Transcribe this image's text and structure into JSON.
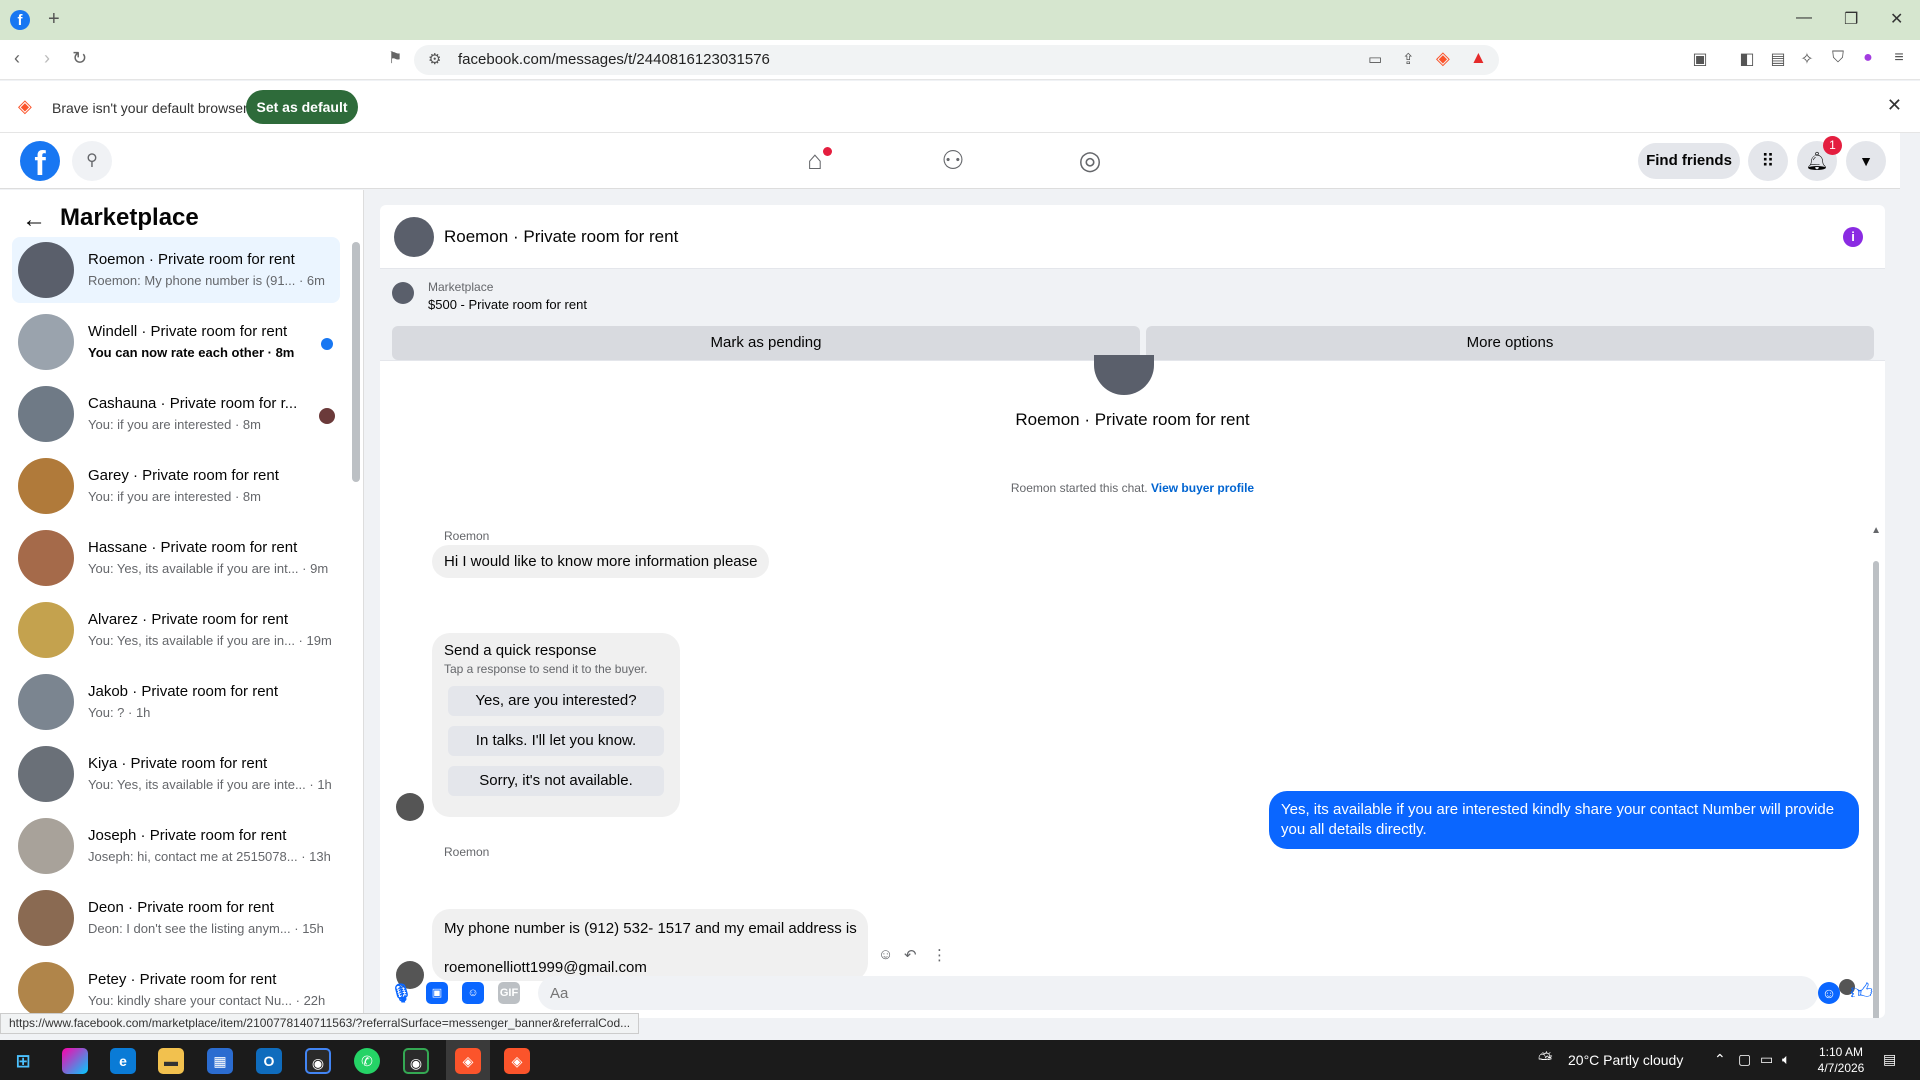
{
  "browser": {
    "tab_icon": "f",
    "url": "facebook.com/messages/t/2440816123031576",
    "infobar_text": "Brave isn't your default browser",
    "set_default_label": "Set as default"
  },
  "fbnav": {
    "logo": "f",
    "find_friends_label": "Find friends",
    "notification_count": "1"
  },
  "sidebar": {
    "title": "Marketplace",
    "conversations": [
      {
        "name": "Roemon · Private room for rent",
        "preview": "Roemon: My phone number is (91...  · 6m",
        "unread": false,
        "active": true,
        "avatar_color": "#5a5f6b"
      },
      {
        "name": "Windell · Private room for rent",
        "preview": "You can now rate each other · 8m",
        "unread": true,
        "active": false,
        "avatar_color": "#9aa3ad"
      },
      {
        "name": "Cashauna · Private room for r...",
        "preview": "You: if you are interested · 8m",
        "unread": false,
        "active": false,
        "avatar_color": "#6f7a86"
      },
      {
        "name": "Garey · Private room for rent",
        "preview": "You: if you are interested · 8m",
        "unread": false,
        "active": false,
        "avatar_color": "#b07a3a"
      },
      {
        "name": "Hassane · Private room for rent",
        "preview": "You: Yes, its available if you are int... · 9m",
        "unread": false,
        "active": false,
        "avatar_color": "#a56a4a"
      },
      {
        "name": "Alvarez · Private room for rent",
        "preview": "You: Yes, its available if you are in... · 19m",
        "unread": false,
        "active": false,
        "avatar_color": "#c4a24e"
      },
      {
        "name": "Jakob · Private room for rent",
        "preview": "You: ? · 1h",
        "unread": false,
        "active": false,
        "avatar_color": "#7b8590"
      },
      {
        "name": "Kiya · Private room for rent",
        "preview": "You: Yes, its available if you are inte... · 1h",
        "unread": false,
        "active": false,
        "avatar_color": "#6a7078"
      },
      {
        "name": "Joseph · Private room for rent",
        "preview": "Joseph: hi, contact me at 2515078... · 13h",
        "unread": false,
        "active": false,
        "avatar_color": "#a8a29a"
      },
      {
        "name": "Deon · Private room for rent",
        "preview": "Deon: I don't see the listing anym... · 15h",
        "unread": false,
        "active": false,
        "avatar_color": "#8a6a52"
      },
      {
        "name": "Petey · Private room for rent",
        "preview": "You: kindly share your contact Nu... · 22h",
        "unread": false,
        "active": false,
        "avatar_color": "#b0854a"
      }
    ]
  },
  "chat": {
    "title": "Roemon · Private room for rent",
    "marketplace_label": "Marketplace",
    "listing": "$500 - Private room for rent",
    "mark_pending_label": "Mark as pending",
    "more_options_label": "More options",
    "started_text": "Roemon started this chat.",
    "view_profile_label": "View buyer profile",
    "sender_name": "Roemon",
    "message_1": "Hi I would like to know more information please",
    "quick_title": "Send a quick response",
    "quick_subtitle": "Tap a response to send it to the buyer.",
    "quick_options": [
      "Yes, are you interested?",
      "In talks. I'll let you know.",
      "Sorry, it's not available."
    ],
    "outgoing": "Yes, its available if you are interested kindly share your contact Number will provide you all details directly.",
    "phone_line_1": "My phone number is (912) 532- 1517 and my email address is",
    "phone_line_2": "roemonelliott1999@gmail.com",
    "composer_placeholder": "Aa"
  },
  "statusbar_url": "https://www.facebook.com/marketplace/item/2100778140711563/?referralSurface=messenger_banner&referralCod...",
  "taskbar": {
    "weather": "20°C  Partly cloudy",
    "time": "1:10 AM",
    "date": "4/7/2026"
  },
  "colors": {
    "fb_blue": "#1877f2",
    "out_bubble": "#0a66ff",
    "brave_accent": "#2e6b3a"
  }
}
